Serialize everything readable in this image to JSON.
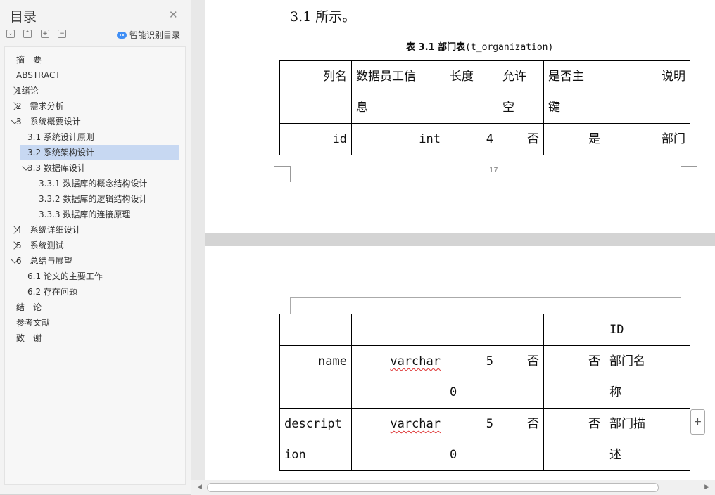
{
  "sidebar": {
    "title": "目录",
    "smart_label": "智能识别目录",
    "toc": [
      {
        "label": "摘　要",
        "level": 1,
        "expand": "none"
      },
      {
        "label": "ABSTRACT",
        "level": 1,
        "expand": "none"
      },
      {
        "label": "1绪论",
        "level": 1,
        "expand": "collapsed"
      },
      {
        "label": "2　需求分析",
        "level": 1,
        "expand": "collapsed"
      },
      {
        "label": "3　系统概要设计",
        "level": 1,
        "expand": "expanded"
      },
      {
        "label": "3.1 系统设计原则",
        "level": 2,
        "expand": "none"
      },
      {
        "label": "3.2 系统架构设计",
        "level": 2,
        "expand": "none",
        "selected": true
      },
      {
        "label": "3.3 数据库设计",
        "level": 2,
        "expand": "expanded"
      },
      {
        "label": "3.3.1 数据库的概念结构设计",
        "level": 3,
        "expand": "none"
      },
      {
        "label": "3.3.2 数据库的逻辑结构设计",
        "level": 3,
        "expand": "none"
      },
      {
        "label": "3.3.3 数据库的连接原理",
        "level": 3,
        "expand": "none"
      },
      {
        "label": "4　系统详细设计",
        "level": 1,
        "expand": "collapsed"
      },
      {
        "label": "5　系统测试",
        "level": 1,
        "expand": "collapsed"
      },
      {
        "label": "6　总结与展望",
        "level": 1,
        "expand": "expanded"
      },
      {
        "label": "6.1 论文的主要工作",
        "level": 2,
        "expand": "none"
      },
      {
        "label": "6.2 存在问题",
        "level": 2,
        "expand": "none"
      },
      {
        "label": "结　论",
        "level": 1,
        "expand": "none"
      },
      {
        "label": "参考文献",
        "level": 1,
        "expand": "none"
      },
      {
        "label": "致　谢",
        "level": 1,
        "expand": "none"
      }
    ]
  },
  "page1": {
    "intro": "3.1 所示。",
    "caption_prefix": "表 3.1 部门表",
    "caption_code": "(t_organization)",
    "page_number": "17",
    "header": {
      "c1": "列名",
      "c2a": "数据员工信",
      "c2b": "息",
      "c3": "长度",
      "c4a": "允许",
      "c4b": "空",
      "c5a": "是否主",
      "c5b": "键",
      "c6": "说明"
    },
    "row": {
      "c1": "id",
      "c2": "int",
      "c3": "4",
      "c4": "否",
      "c5": "是",
      "c6": "部门"
    }
  },
  "page2": {
    "r0": {
      "c6": "ID"
    },
    "r1": {
      "c1": "name",
      "c2": "varchar",
      "c3a": "5",
      "c3b": "0",
      "c4": "否",
      "c5": "否",
      "c6a": "部门名",
      "c6b": "称"
    },
    "r2": {
      "c1a": "descript",
      "c1b": "ion",
      "c2": "varchar",
      "c3a": "5",
      "c3b": "0",
      "c4": "否",
      "c5": "否",
      "c6a": "部门描",
      "c6b": "述"
    }
  },
  "plus_button": "+"
}
